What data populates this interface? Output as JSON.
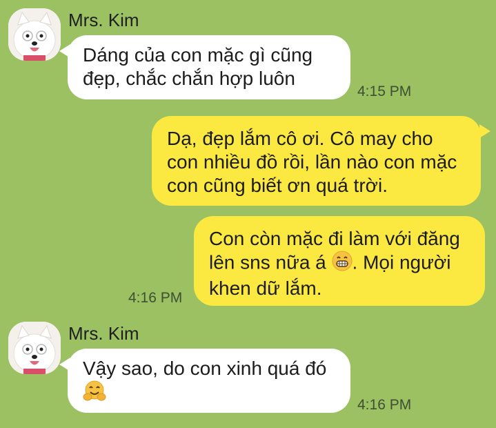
{
  "messages": [
    {
      "sender": "Mrs. Kim",
      "avatar_icon": "samoyed-dog-avatar",
      "lines": [
        "Dáng của con mặc gì cũng",
        "đẹp, chắc chắn hợp luôn"
      ],
      "time": "4:15 PM"
    },
    {
      "lines": [
        "Dạ, đẹp lắm cô ơi. Cô may cho",
        "con nhiều đồ rồi, lần nào con mặc",
        "con cũng biết ơn quá trời."
      ]
    },
    {
      "lines": [
        "Con còn mặc đi làm với đăng",
        "lên sns nữa á",
        ". Mọi người",
        "khen dữ lắm."
      ],
      "emoji_icon": "grinning-face-emoji",
      "time": "4:16 PM"
    },
    {
      "sender": "Mrs. Kim",
      "avatar_icon": "samoyed-dog-avatar",
      "lines": [
        "Vậy sao, do con xinh quá đó"
      ],
      "emoji_icon": "hugging-face-emoji",
      "time": "4:16 PM"
    }
  ],
  "colors": {
    "background": "#9bc163",
    "incoming_bubble": "#ffffff",
    "outgoing_bubble": "#fbe840"
  }
}
